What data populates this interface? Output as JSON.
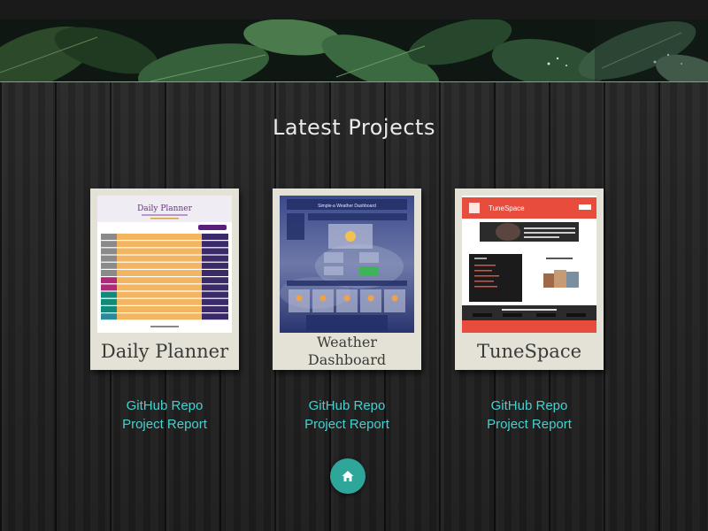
{
  "section": {
    "title": "Latest Projects"
  },
  "projects": [
    {
      "title": "Daily Planner",
      "thumb_title": "Daily Planner",
      "links": {
        "repo": "GitHub Repo",
        "report": "Project Report"
      }
    },
    {
      "title": "Weather Dashboard",
      "title_line1": "Weather",
      "title_line2": "Dashboard",
      "thumb_title": "Simple-a Weather Dashboard",
      "links": {
        "repo": "GitHub Repo",
        "report": "Project Report"
      }
    },
    {
      "title": "TuneSpace",
      "thumb_title": "TuneSpace",
      "links": {
        "repo": "GitHub Repo",
        "report": "Project Report"
      }
    }
  ],
  "home_button": {
    "icon": "home-icon"
  },
  "colors": {
    "link": "#48d0cf",
    "home": "#2ea69a",
    "card": "#e4e2d6"
  }
}
